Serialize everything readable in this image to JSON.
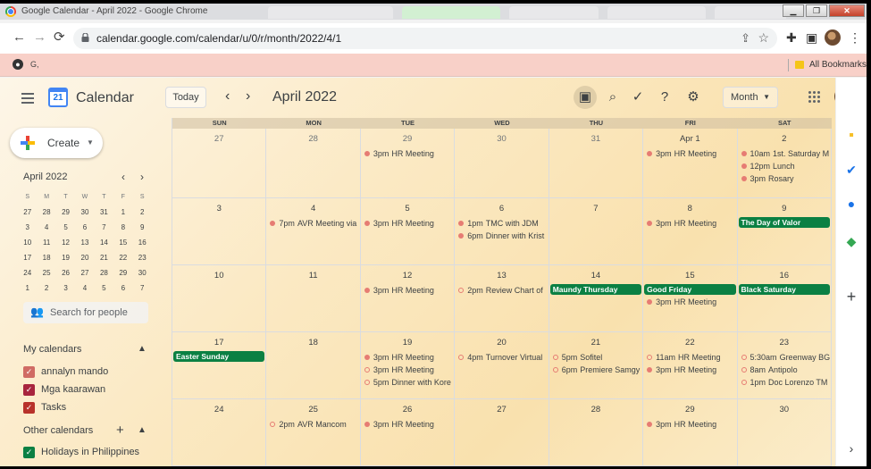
{
  "browser": {
    "window_title": "Google Calendar - April 2022 - Google Chrome",
    "url_host": "calendar.google.com",
    "url_path": "/calendar/u/0/r/month/2022/4/1",
    "bookmark_label": "G,",
    "all_bookmarks": "All Bookmarks",
    "win_min": "▁",
    "win_max": "❐",
    "win_close": "✕",
    "back_glyph": "←",
    "forward_glyph": "→",
    "reload_glyph": "⟳",
    "share_glyph": "⇪",
    "star_glyph": "☆",
    "ext_glyph": "✚",
    "side_glyph": "▣",
    "menu_glyph": "⋮"
  },
  "header": {
    "app_name": "Calendar",
    "logo_day": "21",
    "today_label": "Today",
    "prev_glyph": "‹",
    "next_glyph": "›",
    "month_title": "April 2022",
    "view_label": "Month",
    "view_caret": "▼",
    "icons": {
      "image": "▣",
      "search": "⌕",
      "tasks": "✓",
      "help": "?",
      "settings": "⚙"
    }
  },
  "sidebar": {
    "create_label": "Create",
    "create_caret": "▼",
    "mini_title": "April 2022",
    "mini_prev": "‹",
    "mini_next": "›",
    "mini_dow": [
      "S",
      "M",
      "T",
      "W",
      "T",
      "F",
      "S"
    ],
    "mini_weeks": [
      [
        "27",
        "28",
        "29",
        "30",
        "31",
        "1",
        "2"
      ],
      [
        "3",
        "4",
        "5",
        "6",
        "7",
        "8",
        "9"
      ],
      [
        "10",
        "11",
        "12",
        "13",
        "14",
        "15",
        "16"
      ],
      [
        "17",
        "18",
        "19",
        "20",
        "21",
        "22",
        "23"
      ],
      [
        "24",
        "25",
        "26",
        "27",
        "28",
        "29",
        "30"
      ],
      [
        "1",
        "2",
        "3",
        "4",
        "5",
        "6",
        "7"
      ]
    ],
    "search_icon": "👥",
    "search_placeholder": "Search for people",
    "my_calendars_title": "My calendars",
    "my_calendars": [
      {
        "label": "annalyn mando",
        "color": "#d06b64"
      },
      {
        "label": "Mga kaarawan",
        "color": "#a8253e"
      },
      {
        "label": "Tasks",
        "color": "#b8322b"
      }
    ],
    "other_calendars_title": "Other calendars",
    "other_add": "+",
    "section_caret": "▲",
    "other_calendars": [
      {
        "label": "Holidays in Philippines",
        "color": "#0b8043"
      }
    ],
    "check_glyph": "✓"
  },
  "right_bar": {
    "keep": "▪",
    "tasks": "✔",
    "contacts": "●",
    "maps": "◆",
    "add": "+",
    "expand": "›"
  },
  "calendar": {
    "dow": [
      "SUN",
      "MON",
      "TUE",
      "WED",
      "THU",
      "FRI",
      "SAT"
    ],
    "weeks": [
      [
        {
          "d": "27",
          "muted": true,
          "events": []
        },
        {
          "d": "28",
          "muted": true,
          "events": []
        },
        {
          "d": "29",
          "muted": true,
          "events": [
            {
              "time": "3pm",
              "title": "HR Meeting",
              "dot": "filled"
            }
          ]
        },
        {
          "d": "30",
          "muted": true,
          "events": []
        },
        {
          "d": "31",
          "muted": true,
          "events": []
        },
        {
          "d": "Apr 1",
          "events": [
            {
              "time": "3pm",
              "title": "HR Meeting",
              "dot": "filled"
            }
          ]
        },
        {
          "d": "2",
          "events": [
            {
              "time": "10am",
              "title": "1st. Saturday M",
              "dot": "filled"
            },
            {
              "time": "12pm",
              "title": "Lunch",
              "dot": "filled"
            },
            {
              "time": "3pm",
              "title": "Rosary",
              "dot": "filled"
            }
          ]
        }
      ],
      [
        {
          "d": "3",
          "events": []
        },
        {
          "d": "4",
          "events": [
            {
              "time": "7pm",
              "title": "AVR Meeting via",
              "dot": "filled"
            }
          ]
        },
        {
          "d": "5",
          "events": [
            {
              "time": "3pm",
              "title": "HR Meeting",
              "dot": "filled"
            }
          ]
        },
        {
          "d": "6",
          "events": [
            {
              "time": "1pm",
              "title": "TMC with JDM",
              "dot": "filled"
            },
            {
              "time": "6pm",
              "title": "Dinner with Krist",
              "dot": "filled"
            }
          ]
        },
        {
          "d": "7",
          "events": []
        },
        {
          "d": "8",
          "events": [
            {
              "time": "3pm",
              "title": "HR Meeting",
              "dot": "filled"
            }
          ]
        },
        {
          "d": "9",
          "events": [
            {
              "allday": true,
              "title": "The Day of Valor"
            }
          ]
        }
      ],
      [
        {
          "d": "10",
          "events": []
        },
        {
          "d": "11",
          "events": []
        },
        {
          "d": "12",
          "events": [
            {
              "time": "3pm",
              "title": "HR Meeting",
              "dot": "filled"
            }
          ]
        },
        {
          "d": "13",
          "events": [
            {
              "time": "2pm",
              "title": "Review Chart of",
              "dot": "hollow"
            }
          ]
        },
        {
          "d": "14",
          "events": [
            {
              "allday": true,
              "title": "Maundy Thursday"
            }
          ]
        },
        {
          "d": "15",
          "events": [
            {
              "allday": true,
              "title": "Good Friday"
            },
            {
              "time": "3pm",
              "title": "HR Meeting",
              "dot": "filled"
            }
          ]
        },
        {
          "d": "16",
          "events": [
            {
              "allday": true,
              "title": "Black Saturday"
            }
          ]
        }
      ],
      [
        {
          "d": "17",
          "events": [
            {
              "allday": true,
              "title": "Easter Sunday"
            }
          ]
        },
        {
          "d": "18",
          "events": []
        },
        {
          "d": "19",
          "events": [
            {
              "time": "3pm",
              "title": "HR Meeting",
              "dot": "filled"
            },
            {
              "time": "3pm",
              "title": "HR Meeting",
              "dot": "hollow"
            },
            {
              "time": "5pm",
              "title": "Dinner with Kore",
              "dot": "hollow"
            }
          ]
        },
        {
          "d": "20",
          "events": [
            {
              "time": "4pm",
              "title": "Turnover Virtual",
              "dot": "hollow"
            }
          ]
        },
        {
          "d": "21",
          "events": [
            {
              "time": "5pm",
              "title": "Sofitel",
              "dot": "hollow"
            },
            {
              "time": "6pm",
              "title": "Premiere Samgy",
              "dot": "hollow"
            }
          ]
        },
        {
          "d": "22",
          "events": [
            {
              "time": "11am",
              "title": "HR Meeting",
              "dot": "hollow"
            },
            {
              "time": "3pm",
              "title": "HR Meeting",
              "dot": "filled"
            }
          ]
        },
        {
          "d": "23",
          "events": [
            {
              "time": "5:30am",
              "title": "Greenway BG",
              "dot": "hollow"
            },
            {
              "time": "8am",
              "title": "Antipolo",
              "dot": "hollow"
            },
            {
              "time": "1pm",
              "title": "Doc Lorenzo TM",
              "dot": "hollow"
            }
          ]
        }
      ],
      [
        {
          "d": "24",
          "events": []
        },
        {
          "d": "25",
          "events": [
            {
              "time": "2pm",
              "title": "AVR Mancom",
              "dot": "hollow"
            }
          ]
        },
        {
          "d": "26",
          "events": [
            {
              "time": "3pm",
              "title": "HR Meeting",
              "dot": "filled"
            }
          ]
        },
        {
          "d": "27",
          "events": []
        },
        {
          "d": "28",
          "events": []
        },
        {
          "d": "29",
          "events": [
            {
              "time": "3pm",
              "title": "HR Meeting",
              "dot": "filled"
            }
          ]
        },
        {
          "d": "30",
          "events": []
        }
      ]
    ]
  }
}
